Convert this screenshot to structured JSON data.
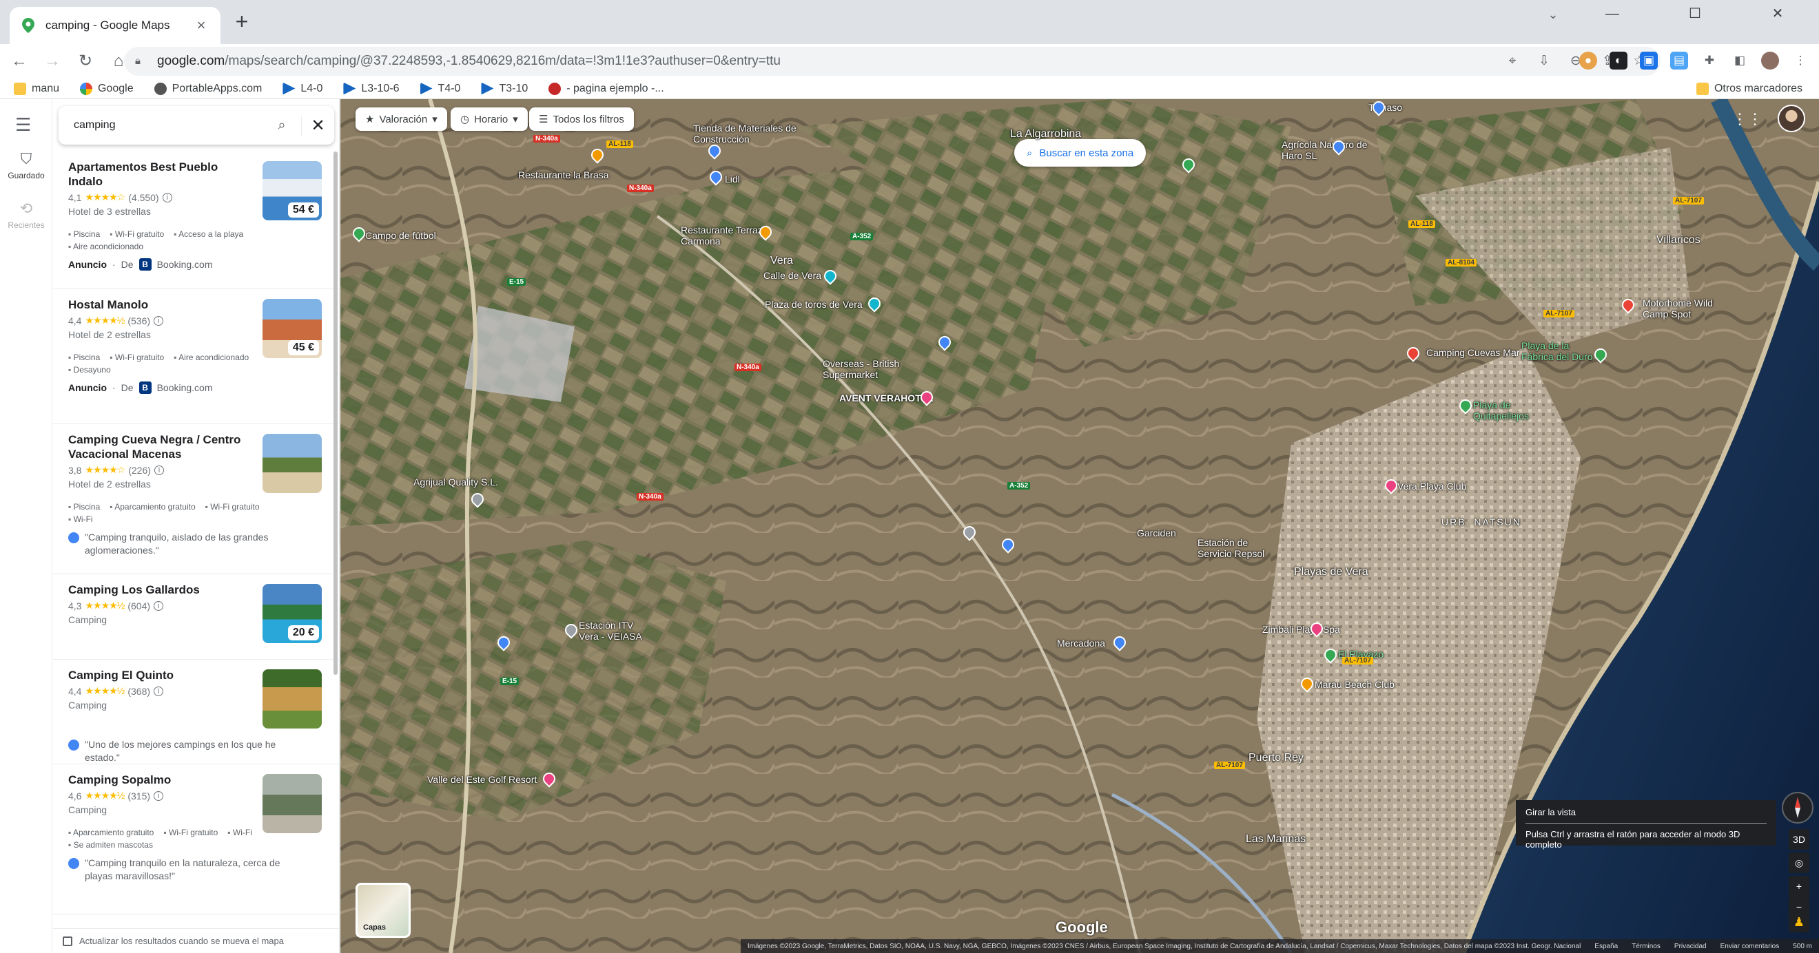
{
  "browser": {
    "tab_title": "camping - Google Maps",
    "url_host": "google.com",
    "url_path": "/maps/search/camping/@37.2248593,-1.8540629,8216m/data=!3m1!1e3?authuser=0&entry=ttu",
    "bookmarks": [
      "manu",
      "Google",
      "PortableApps.com",
      "L4-0",
      "L3-10-6",
      "T4-0",
      "T3-10",
      "- pagina ejemplo -..."
    ],
    "other_bookmarks": "Otros marcadores"
  },
  "rail": {
    "saved": "Guardado",
    "recent": "Recientes"
  },
  "search": {
    "value": "camping"
  },
  "results": [
    {
      "title": "Apartamentos Best Pueblo Indalo",
      "rating": "4,1",
      "stars": "★★★★☆",
      "reviews": "(4.550)",
      "category": "Hotel de 3 estrellas",
      "price": "54 €",
      "amenities": [
        "Piscina",
        "Wi-Fi gratuito",
        "Acceso a la playa",
        "Aire acondicionado"
      ],
      "ad_label": "Anuncio",
      "ad_from": "De",
      "ad_source": "Booking.com"
    },
    {
      "title": "Hostal Manolo",
      "rating": "4,4",
      "stars": "★★★★½",
      "reviews": "(536)",
      "category": "Hotel de 2 estrellas",
      "price": "45 €",
      "amenities": [
        "Piscina",
        "Wi-Fi gratuito",
        "Aire acondicionado",
        "Desayuno"
      ],
      "ad_label": "Anuncio",
      "ad_from": "De",
      "ad_source": "Booking.com"
    },
    {
      "title": "Camping Cueva Negra / Centro Vacacional Macenas",
      "rating": "3,8",
      "stars": "★★★★☆",
      "reviews": "(226)",
      "category": "Hotel de 2 estrellas",
      "amenities": [
        "Piscina",
        "Aparcamiento gratuito",
        "Wi-Fi gratuito",
        "Wi-Fi"
      ],
      "quote": "\"Camping tranquilo, aislado de las grandes aglomeraciones.\""
    },
    {
      "title": "Camping Los Gallardos",
      "rating": "4,3",
      "stars": "★★★★½",
      "reviews": "(604)",
      "category": "Camping",
      "price": "20 €"
    },
    {
      "title": "Camping El Quinto",
      "rating": "4,4",
      "stars": "★★★★½",
      "reviews": "(368)",
      "category": "Camping",
      "quote": "\"Uno de los mejores campings en los que he estado.\""
    },
    {
      "title": "Camping Sopalmo",
      "rating": "4,6",
      "stars": "★★★★½",
      "reviews": "(315)",
      "category": "Camping",
      "amenities": [
        "Aparcamiento gratuito",
        "Wi-Fi gratuito",
        "Wi-Fi",
        "Se admiten mascotas"
      ],
      "quote": "\"Camping tranquilo en la naturaleza, cerca de playas maravillosas!\""
    }
  ],
  "panel_footer": "Actualizar los resultados cuando se mueva el mapa",
  "map": {
    "filters": [
      "Valoración",
      "Horario",
      "Todos los filtros"
    ],
    "search_area": "Buscar en esta zona",
    "places": [
      "La Algarrobina",
      "Tomaso",
      "Agrícola Navarro de Haro SL",
      "Tienda de Materiales de Construcción",
      "Restaurante la Brasa",
      "Lidl",
      "Restaurante Terraza Carmona",
      "Campo de fútbol",
      "Vera",
      "Calle de Vera",
      "Plaza de toros de Vera",
      "Villaricos",
      "Motorhome Wild Camp Spot",
      "Overseas - British Supermarket",
      "AVENT VERAHOTEL",
      "Camping Cuevas Mar",
      "Playa de la Fábrica del Duro",
      "Playa de Quitapellejos",
      "Vera Playa Club",
      "URB. NATSUN",
      "Garciden",
      "Estación de Servicio Repsol",
      "Playas de Vera",
      "Zimbali Playa Spa",
      "El Playazo",
      "Marau Beach Club",
      "Mercadona",
      "Estación ITV Vera - VEIASA",
      "Puerto Rey",
      "Valle del Este Golf Resort",
      "Las Marinas",
      "Agrijual Quality S.L."
    ],
    "tooltip_title": "Girar la vista",
    "tooltip_text": "Pulsa Ctrl y arrastra el ratón para acceder al modo 3D completo",
    "layers_label": "Capas",
    "three_d": "3D",
    "google": "Google",
    "attribution": "Imágenes ©2023 Google, TerraMetrics, Datos SIO, NOAA, U.S. Navy, NGA, GEBCO, Imágenes ©2023 CNES / Airbus, European Space Imaging, Instituto de Cartografía de Andalucía, Landsat / Copernicus, Maxar Technologies, Datos del mapa ©2023 Inst. Geogr. Nacional",
    "footer_links": [
      "España",
      "Términos",
      "Privacidad",
      "Enviar comentarios"
    ],
    "scale": "500 m"
  }
}
